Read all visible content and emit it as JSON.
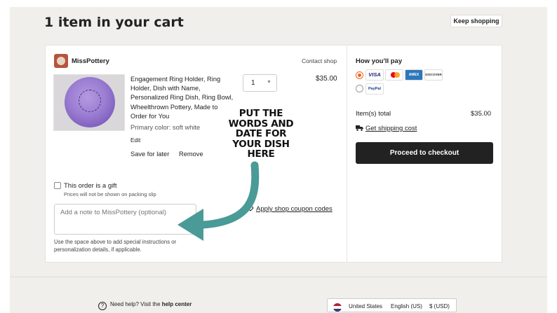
{
  "header": {
    "title": "1 item in your cart",
    "keep_shopping": "Keep shopping"
  },
  "shop": {
    "name": "MissPottery",
    "contact": "Contact shop"
  },
  "item": {
    "title": "Engagement Ring Holder, Ring Holder, Dish with Name, Personalized Ring Dish, Ring Bowl, Wheelthrown Pottery, Made to Order for You",
    "primary_color": "Primary color: soft white",
    "edit": "Edit",
    "save_for_later": "Save for later",
    "remove": "Remove",
    "quantity": "1",
    "price": "$35.00"
  },
  "gift": {
    "label": "This order is a gift",
    "sub": "Prices will not be shown on packing slip"
  },
  "note": {
    "placeholder": "Add a note to MissPottery (optional)",
    "help": "Use the space above to add special instructions or personalization details, if applicable."
  },
  "coupon": {
    "label": "Apply shop coupon codes"
  },
  "payment": {
    "heading": "How you'll pay",
    "methods": [
      "VISA",
      "mastercard",
      "AMEX",
      "DISCOVER",
      "PayPal"
    ],
    "selected_method": "card"
  },
  "summary": {
    "items_total_label": "Item(s) total",
    "items_total_value": "$35.00",
    "shipping": "Get shipping cost",
    "checkout": "Proceed to checkout"
  },
  "annotation": {
    "text": "PUT THE WORDS AND DATE FOR YOUR DISH HERE"
  },
  "footer": {
    "help_prefix": "Need help? Visit the ",
    "help_link": "help center",
    "region": "United States",
    "language": "English (US)",
    "currency": "$ (USD)"
  },
  "colors": {
    "accent": "#f1641e",
    "arrow": "#4a9a97",
    "checkout_bg": "#222222",
    "page_bg": "#f0efeb"
  }
}
